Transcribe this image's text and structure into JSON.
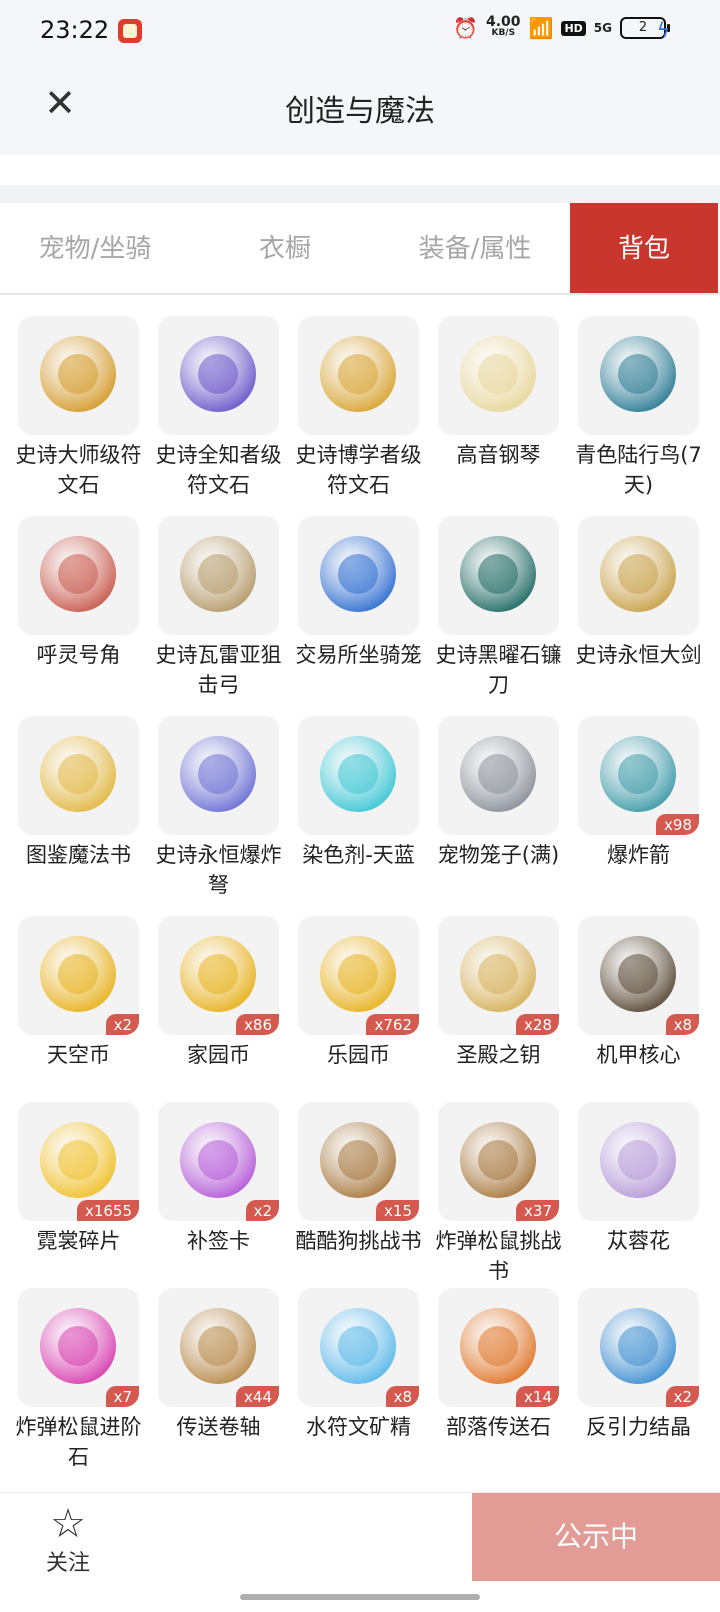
{
  "status_bar": {
    "time": "23:22",
    "speed_value": "4.00",
    "speed_unit": "KB/S",
    "hd": "HD",
    "signal": "5G",
    "battery": "2"
  },
  "header": {
    "title": "创造与魔法"
  },
  "tabs": [
    {
      "label": "宠物/坐骑",
      "active": false
    },
    {
      "label": "衣橱",
      "active": false
    },
    {
      "label": "装备/属性",
      "active": false
    },
    {
      "label": "背包",
      "active": true
    }
  ],
  "items": [
    {
      "name": "史诗大师级符文石",
      "qty": "",
      "icon": "rune-orange-icon",
      "color": "#d59a2a"
    },
    {
      "name": "史诗全知者级符文石",
      "qty": "",
      "icon": "rune-purple-icon",
      "color": "#6a56c9"
    },
    {
      "name": "史诗博学者级符文石",
      "qty": "",
      "icon": "rune-gold-icon",
      "color": "#d8a433"
    },
    {
      "name": "高音钢琴",
      "qty": "",
      "icon": "piano-icon",
      "color": "#e8d79a"
    },
    {
      "name": "青色陆行鸟(7天)",
      "qty": "",
      "icon": "bird-icon",
      "color": "#2b7b94"
    },
    {
      "name": "呼灵号角",
      "qty": "",
      "icon": "horn-icon",
      "color": "#c85a4d"
    },
    {
      "name": "史诗瓦雷亚狙击弓",
      "qty": "",
      "icon": "bow-icon",
      "color": "#b59a6a"
    },
    {
      "name": "交易所坐骑笼",
      "qty": "",
      "icon": "cage-icon",
      "color": "#2f6fd1"
    },
    {
      "name": "史诗黑曜石镰刀",
      "qty": "",
      "icon": "scythe-icon",
      "color": "#1f6a63"
    },
    {
      "name": "史诗永恒大剑",
      "qty": "",
      "icon": "sword-icon",
      "color": "#c9a24a"
    },
    {
      "name": "图鉴魔法书",
      "qty": "",
      "icon": "book-icon",
      "color": "#e2b843"
    },
    {
      "name": "史诗永恒爆炸弩",
      "qty": "",
      "icon": "crossbow-icon",
      "color": "#6b6fd3"
    },
    {
      "name": "染色剂-天蓝",
      "qty": "",
      "icon": "potion-icon",
      "color": "#3cc6d4"
    },
    {
      "name": "宠物笼子(满)",
      "qty": "",
      "icon": "pet-cage-icon",
      "color": "#8a8f99"
    },
    {
      "name": "爆炸箭",
      "qty": "x98",
      "icon": "arrow-icon",
      "color": "#3e9aa8"
    },
    {
      "name": "天空币",
      "qty": "x2",
      "icon": "coin-bow-icon",
      "color": "#e8b21e"
    },
    {
      "name": "家园币",
      "qty": "x86",
      "icon": "coin-home-icon",
      "color": "#e8b21e"
    },
    {
      "name": "乐园币",
      "qty": "x762",
      "icon": "coin-park-icon",
      "color": "#e8b21e"
    },
    {
      "name": "圣殿之钥",
      "qty": "x28",
      "icon": "key-icon",
      "color": "#d7b15a"
    },
    {
      "name": "机甲核心",
      "qty": "x8",
      "icon": "mech-core-icon",
      "color": "#5a4a36"
    },
    {
      "name": "霓裳碎片",
      "qty": "x1655",
      "icon": "shirt-icon",
      "color": "#f0c12a"
    },
    {
      "name": "补签卡",
      "qty": "x2",
      "icon": "card-icon",
      "color": "#b45ad8"
    },
    {
      "name": "酷酷狗挑战书",
      "qty": "x15",
      "icon": "wanted-dog-icon",
      "color": "#a8793f"
    },
    {
      "name": "炸弹松鼠挑战书",
      "qty": "x37",
      "icon": "wanted-squirrel-icon",
      "color": "#a8793f"
    },
    {
      "name": "苁蓉花",
      "qty": "",
      "icon": "flower-icon",
      "color": "#b69ad8"
    },
    {
      "name": "炸弹松鼠进阶石",
      "qty": "x7",
      "icon": "gem-icon",
      "color": "#d83fb0"
    },
    {
      "name": "传送卷轴",
      "qty": "x44",
      "icon": "scroll-icon",
      "color": "#b88a4a"
    },
    {
      "name": "水符文矿精",
      "qty": "x8",
      "icon": "ice-crystal-icon",
      "color": "#5ab8ea"
    },
    {
      "name": "部落传送石",
      "qty": "x14",
      "icon": "stone-icon",
      "color": "#e0762a"
    },
    {
      "name": "反引力结晶",
      "qty": "x2",
      "icon": "crystal-icon",
      "color": "#3f8fd1"
    }
  ],
  "bottom": {
    "follow_label": "关注",
    "public_label": "公示中"
  }
}
